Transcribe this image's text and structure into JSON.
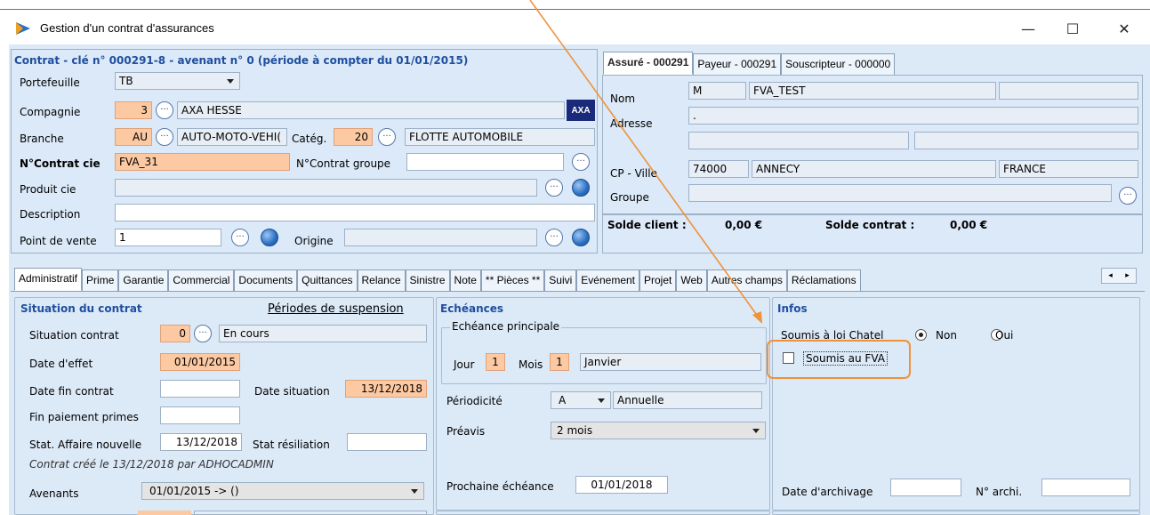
{
  "window": {
    "title": "Gestion d'un contrat d'assurances",
    "minimize": "—",
    "maximize": "☐",
    "close": "✕"
  },
  "contrat": {
    "header": "Contrat - clé n° 000291-8 - avenant n° 0 (période à compter du 01/01/2015)",
    "portefeuille_label": "Portefeuille",
    "portefeuille_value": "TB",
    "compagnie_label": "Compagnie",
    "compagnie_code": "3",
    "compagnie_name": "AXA HESSE",
    "branche_label": "Branche",
    "branche_code": "AU",
    "branche_name": "AUTO-MOTO-VEHI(",
    "categ_label": "Catég.",
    "categ_code": "20",
    "categ_name": "FLOTTE AUTOMOBILE",
    "ncontrat_label": "N°Contrat cie",
    "ncontrat_value": "FVA_31",
    "ncontrat_groupe_label": "N°Contrat groupe",
    "ncontrat_groupe_value": "",
    "produit_label": "Produit cie",
    "produit_value": "",
    "description_label": "Description",
    "description_value": "",
    "point_vente_label": "Point de vente",
    "point_vente_value": "1",
    "origine_label": "Origine",
    "origine_value": "",
    "logo_text": "AXA"
  },
  "assure": {
    "tabs": [
      "Assuré - 000291",
      "Payeur - 000291",
      "Souscripteur - 000000"
    ],
    "nom_label": "Nom",
    "civilite": "M",
    "nom_value": "FVA_TEST",
    "adresse_label": "Adresse",
    "adresse_value": ".",
    "cp_label": "CP - Ville",
    "cp_value": "74000",
    "ville_value": "ANNECY",
    "pays_value": "FRANCE",
    "groupe_label": "Groupe",
    "solde_client_label": "Solde client :",
    "solde_client_value": "0,00 €",
    "solde_contrat_label": "Solde contrat :",
    "solde_contrat_value": "0,00 €"
  },
  "tabs": [
    "Administratif",
    "Prime",
    "Garantie",
    "Commercial",
    "Documents",
    "Quittances",
    "Relance",
    "Sinistre",
    "Note",
    "** Pièces **",
    "Suivi",
    "Evénement",
    "Projet",
    "Web",
    "Autres champs",
    "Réclamations"
  ],
  "tab_scroll": [
    "◂",
    "▸"
  ],
  "situation": {
    "title": "Situation du contrat",
    "periodes_link": "Périodes de suspension",
    "situation_label": "Situation contrat",
    "situation_code": "0",
    "situation_value": "En cours",
    "date_effet_label": "Date d'effet",
    "date_effet_value": "01/01/2015",
    "date_fin_label": "Date fin contrat",
    "date_fin_value": "",
    "date_situation_label": "Date situation",
    "date_situation_value": "13/12/2018",
    "fin_paiement_label": "Fin paiement primes",
    "fin_paiement_value": "",
    "stat_affaire_label": "Stat. Affaire nouvelle",
    "stat_affaire_value": "13/12/2018",
    "stat_resil_label": "Stat résiliation",
    "stat_resil_value": "",
    "created_note": "Contrat créé le 13/12/2018 par ADHOCADMIN",
    "avenants_label": "Avenants",
    "avenants_value": "01/01/2015 -> ()"
  },
  "echeances": {
    "title": "Echéances",
    "principale_title": "Echéance principale",
    "jour_label": "Jour",
    "jour_value": "1",
    "mois_label": "Mois",
    "mois_value": "1",
    "mois_name": "Janvier",
    "periodicite_label": "Périodicité",
    "periodicite_code": "A",
    "periodicite_name": "Annuelle",
    "preavis_label": "Préavis",
    "preavis_value": "2 mois",
    "prochaine_label": "Prochaine échéance",
    "prochaine_value": "01/01/2018"
  },
  "infos": {
    "title": "Infos",
    "chatel_label": "Soumis à loi Chatel",
    "non_label": "Non",
    "oui_label": "Oui",
    "fva_label": "Soumis au FVA",
    "archivage_label": "Date d'archivage",
    "archivage_value": "",
    "archi_label": "N° archi.",
    "archi_value": ""
  },
  "colors": {
    "highlight": "#f0923a",
    "orange_field": "#fcc9a2",
    "header_blue": "#1f4f9e"
  }
}
